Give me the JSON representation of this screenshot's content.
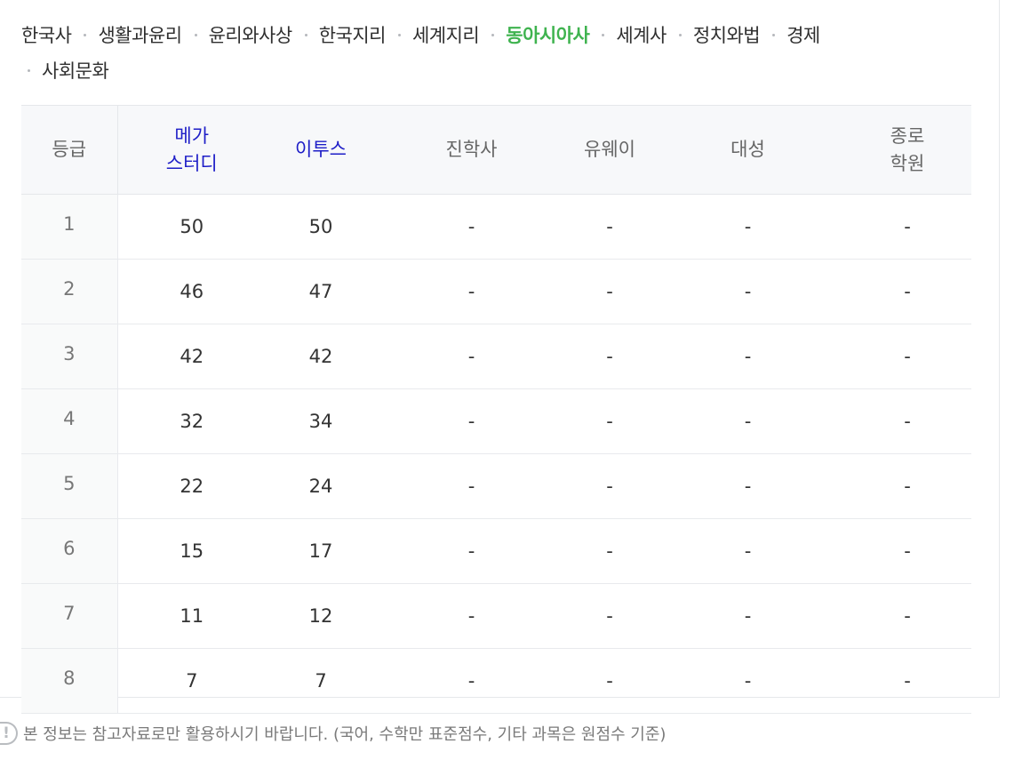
{
  "tabs": {
    "row1": [
      "한국사",
      "생활과윤리",
      "윤리와사상",
      "한국지리",
      "세계지리",
      "동아시아사",
      "세계사",
      "정치와법",
      "경제"
    ],
    "row2": [
      "사회문화"
    ],
    "active": "동아시아사"
  },
  "colors": {
    "active_tab": "#3fb34f",
    "highlight_header": "#1d1dc7"
  },
  "table": {
    "headers": {
      "grade": "등급",
      "megastudy_line1": "메가",
      "megastudy_line2": "스터디",
      "etoos": "이투스",
      "jinhaksa": "진학사",
      "uway": "유웨이",
      "daesung": "대성",
      "jongro_line1": "종로",
      "jongro_line2": "학원"
    },
    "rows": [
      {
        "grade": "1",
        "megastudy": "50",
        "etoos": "50",
        "jinhaksa": "-",
        "uway": "-",
        "daesung": "-",
        "jongro": "-"
      },
      {
        "grade": "2",
        "megastudy": "46",
        "etoos": "47",
        "jinhaksa": "-",
        "uway": "-",
        "daesung": "-",
        "jongro": "-"
      },
      {
        "grade": "3",
        "megastudy": "42",
        "etoos": "42",
        "jinhaksa": "-",
        "uway": "-",
        "daesung": "-",
        "jongro": "-"
      },
      {
        "grade": "4",
        "megastudy": "32",
        "etoos": "34",
        "jinhaksa": "-",
        "uway": "-",
        "daesung": "-",
        "jongro": "-"
      },
      {
        "grade": "5",
        "megastudy": "22",
        "etoos": "24",
        "jinhaksa": "-",
        "uway": "-",
        "daesung": "-",
        "jongro": "-"
      },
      {
        "grade": "6",
        "megastudy": "15",
        "etoos": "17",
        "jinhaksa": "-",
        "uway": "-",
        "daesung": "-",
        "jongro": "-"
      },
      {
        "grade": "7",
        "megastudy": "11",
        "etoos": "12",
        "jinhaksa": "-",
        "uway": "-",
        "daesung": "-",
        "jongro": "-"
      },
      {
        "grade": "8",
        "megastudy": "7",
        "etoos": "7",
        "jinhaksa": "-",
        "uway": "-",
        "daesung": "-",
        "jongro": "-"
      }
    ]
  },
  "notice": {
    "icon": "exclamation-icon",
    "text": "본 정보는 참고자료로만 활용하시기 바랍니다. (국어, 수학만 표준점수, 기타 과목은 원점수 기준)"
  }
}
